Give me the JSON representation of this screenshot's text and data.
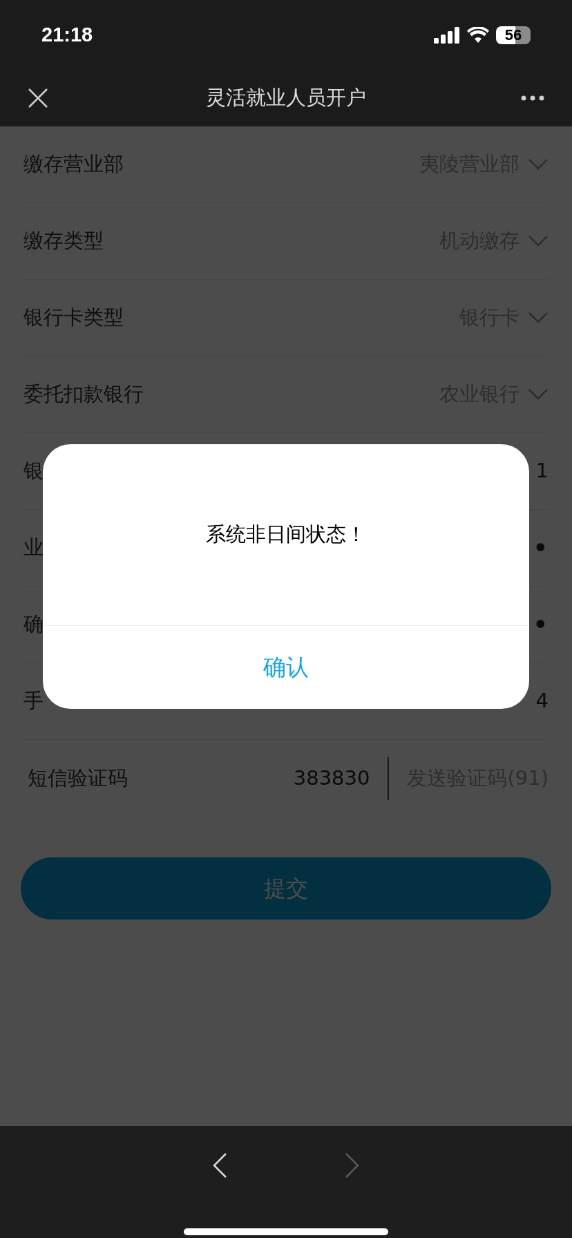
{
  "status_bar": {
    "time": "21:18",
    "battery": "56"
  },
  "nav": {
    "title": "灵活就业人员开户"
  },
  "form": {
    "rows": [
      {
        "kind": "select",
        "label": "缴存营业部",
        "value": "夷陵营业部"
      },
      {
        "kind": "select",
        "label": "缴存类型",
        "value": "机动缴存"
      },
      {
        "kind": "select",
        "label": "银行卡类型",
        "value": "银行卡"
      },
      {
        "kind": "select",
        "label": "委托扣款银行",
        "value": "农业银行"
      },
      {
        "kind": "text",
        "label": "银",
        "value": "1"
      },
      {
        "kind": "secret",
        "label": "业",
        "value": "•"
      },
      {
        "kind": "secret",
        "label": "确",
        "value": "•"
      },
      {
        "kind": "text",
        "label": "手",
        "value": "4"
      },
      {
        "kind": "code",
        "label": "短信验证码",
        "value": "383830",
        "action": "发送验证码(91)"
      }
    ]
  },
  "submit": {
    "label": "提交"
  },
  "dialog": {
    "message": "系统非日间状态！",
    "confirm": "确认"
  },
  "toolbar": {
    "back_disabled": false,
    "forward_disabled": true
  }
}
